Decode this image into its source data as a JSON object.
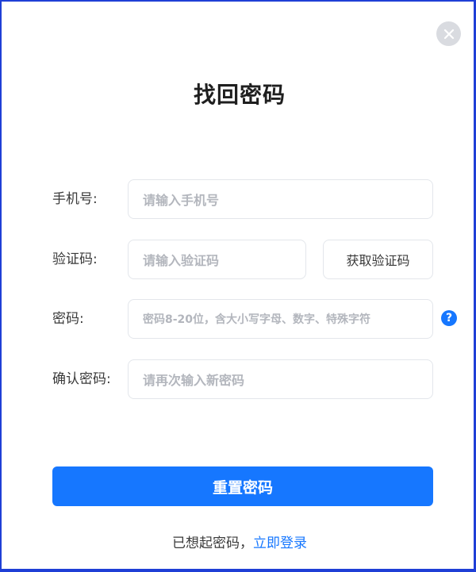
{
  "dialog": {
    "title": "找回密码",
    "close_icon": "close-icon"
  },
  "form": {
    "phone": {
      "label": "手机号:",
      "placeholder": "请输入手机号"
    },
    "code": {
      "label": "验证码:",
      "placeholder": "请输入验证码",
      "button_label": "获取验证码"
    },
    "password": {
      "label": "密码:",
      "placeholder": "密码8-20位，含大小写字母、数字、特殊字符",
      "help_icon": "?"
    },
    "confirm": {
      "label": "确认密码:",
      "placeholder": "请再次输入新密码"
    }
  },
  "submit_label": "重置密码",
  "footer": {
    "text": "已想起密码，",
    "link": "立即登录"
  },
  "colors": {
    "accent": "#1677ff",
    "frame": "#1f3fd6",
    "close_bg": "#d9dbe0"
  }
}
